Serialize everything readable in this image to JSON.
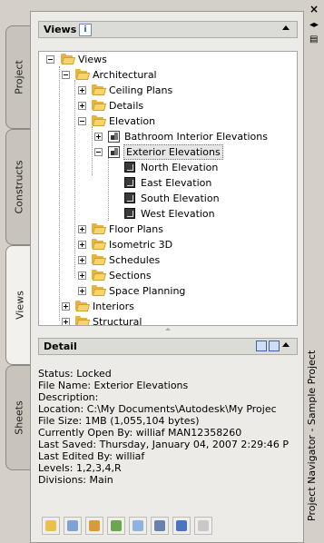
{
  "side_tabs": [
    "Project",
    "Constructs",
    "Views",
    "Sheets"
  ],
  "active_tab": "Views",
  "views_section": {
    "title": "Views",
    "info_icon": "i"
  },
  "tree": {
    "root": "Views",
    "architectural": "Architectural",
    "ceiling_plans": "Ceiling Plans",
    "details": "Details",
    "elevation": "Elevation",
    "bathroom": "Bathroom Interior Elevations",
    "exterior": "Exterior Elevations",
    "north": "North Elevation",
    "east": "East Elevation",
    "south": "South Elevation",
    "west": "West Elevation",
    "floor_plans": "Floor Plans",
    "isometric": "Isometric 3D",
    "schedules": "Schedules",
    "sections": "Sections",
    "space_planning": "Space Planning",
    "interiors": "Interiors",
    "structural": "Structural"
  },
  "detail_section": {
    "title": "Detail",
    "lines": [
      "Status: Locked",
      "File Name: Exterior Elevations",
      "Description:",
      "Location: C:\\My Documents\\Autodesk\\My Projec",
      "File Size: 1MB (1,055,104 bytes)",
      "Currently Open By: williaf MAN12358260",
      "Last Saved: Thursday, January 04, 2007  2:29:46 P",
      "Last Edited By: williaf",
      "Levels: 1,2,3,4,R",
      "Divisions: Main"
    ]
  },
  "toolbar": {
    "buttons": [
      "add-view",
      "add-detail-view",
      "add-section-view",
      "regenerate",
      "properties",
      "close-all",
      "refresh",
      "repath"
    ]
  },
  "palette": {
    "title": "Project Navigator - Sample Project",
    "close_glyph": "×"
  }
}
